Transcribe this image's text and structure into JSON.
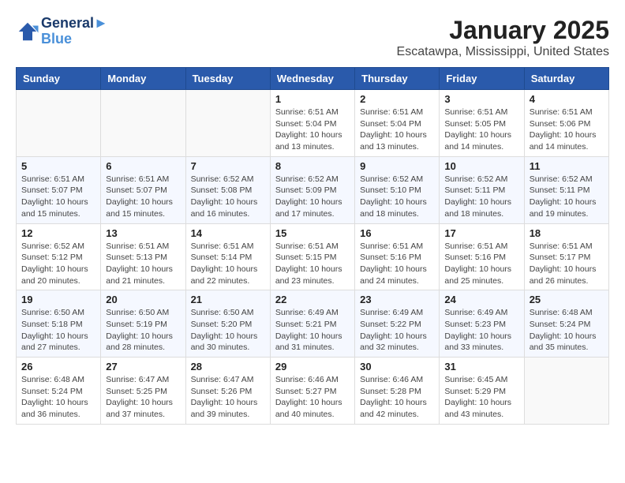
{
  "logo": {
    "line1": "General",
    "line2": "Blue"
  },
  "title": "January 2025",
  "subtitle": "Escatawpa, Mississippi, United States",
  "days_of_week": [
    "Sunday",
    "Monday",
    "Tuesday",
    "Wednesday",
    "Thursday",
    "Friday",
    "Saturday"
  ],
  "weeks": [
    [
      {
        "day": "",
        "info": ""
      },
      {
        "day": "",
        "info": ""
      },
      {
        "day": "",
        "info": ""
      },
      {
        "day": "1",
        "info": "Sunrise: 6:51 AM\nSunset: 5:04 PM\nDaylight: 10 hours\nand 13 minutes."
      },
      {
        "day": "2",
        "info": "Sunrise: 6:51 AM\nSunset: 5:04 PM\nDaylight: 10 hours\nand 13 minutes."
      },
      {
        "day": "3",
        "info": "Sunrise: 6:51 AM\nSunset: 5:05 PM\nDaylight: 10 hours\nand 14 minutes."
      },
      {
        "day": "4",
        "info": "Sunrise: 6:51 AM\nSunset: 5:06 PM\nDaylight: 10 hours\nand 14 minutes."
      }
    ],
    [
      {
        "day": "5",
        "info": "Sunrise: 6:51 AM\nSunset: 5:07 PM\nDaylight: 10 hours\nand 15 minutes."
      },
      {
        "day": "6",
        "info": "Sunrise: 6:51 AM\nSunset: 5:07 PM\nDaylight: 10 hours\nand 15 minutes."
      },
      {
        "day": "7",
        "info": "Sunrise: 6:52 AM\nSunset: 5:08 PM\nDaylight: 10 hours\nand 16 minutes."
      },
      {
        "day": "8",
        "info": "Sunrise: 6:52 AM\nSunset: 5:09 PM\nDaylight: 10 hours\nand 17 minutes."
      },
      {
        "day": "9",
        "info": "Sunrise: 6:52 AM\nSunset: 5:10 PM\nDaylight: 10 hours\nand 18 minutes."
      },
      {
        "day": "10",
        "info": "Sunrise: 6:52 AM\nSunset: 5:11 PM\nDaylight: 10 hours\nand 18 minutes."
      },
      {
        "day": "11",
        "info": "Sunrise: 6:52 AM\nSunset: 5:11 PM\nDaylight: 10 hours\nand 19 minutes."
      }
    ],
    [
      {
        "day": "12",
        "info": "Sunrise: 6:52 AM\nSunset: 5:12 PM\nDaylight: 10 hours\nand 20 minutes."
      },
      {
        "day": "13",
        "info": "Sunrise: 6:51 AM\nSunset: 5:13 PM\nDaylight: 10 hours\nand 21 minutes."
      },
      {
        "day": "14",
        "info": "Sunrise: 6:51 AM\nSunset: 5:14 PM\nDaylight: 10 hours\nand 22 minutes."
      },
      {
        "day": "15",
        "info": "Sunrise: 6:51 AM\nSunset: 5:15 PM\nDaylight: 10 hours\nand 23 minutes."
      },
      {
        "day": "16",
        "info": "Sunrise: 6:51 AM\nSunset: 5:16 PM\nDaylight: 10 hours\nand 24 minutes."
      },
      {
        "day": "17",
        "info": "Sunrise: 6:51 AM\nSunset: 5:16 PM\nDaylight: 10 hours\nand 25 minutes."
      },
      {
        "day": "18",
        "info": "Sunrise: 6:51 AM\nSunset: 5:17 PM\nDaylight: 10 hours\nand 26 minutes."
      }
    ],
    [
      {
        "day": "19",
        "info": "Sunrise: 6:50 AM\nSunset: 5:18 PM\nDaylight: 10 hours\nand 27 minutes."
      },
      {
        "day": "20",
        "info": "Sunrise: 6:50 AM\nSunset: 5:19 PM\nDaylight: 10 hours\nand 28 minutes."
      },
      {
        "day": "21",
        "info": "Sunrise: 6:50 AM\nSunset: 5:20 PM\nDaylight: 10 hours\nand 30 minutes."
      },
      {
        "day": "22",
        "info": "Sunrise: 6:49 AM\nSunset: 5:21 PM\nDaylight: 10 hours\nand 31 minutes."
      },
      {
        "day": "23",
        "info": "Sunrise: 6:49 AM\nSunset: 5:22 PM\nDaylight: 10 hours\nand 32 minutes."
      },
      {
        "day": "24",
        "info": "Sunrise: 6:49 AM\nSunset: 5:23 PM\nDaylight: 10 hours\nand 33 minutes."
      },
      {
        "day": "25",
        "info": "Sunrise: 6:48 AM\nSunset: 5:24 PM\nDaylight: 10 hours\nand 35 minutes."
      }
    ],
    [
      {
        "day": "26",
        "info": "Sunrise: 6:48 AM\nSunset: 5:24 PM\nDaylight: 10 hours\nand 36 minutes."
      },
      {
        "day": "27",
        "info": "Sunrise: 6:47 AM\nSunset: 5:25 PM\nDaylight: 10 hours\nand 37 minutes."
      },
      {
        "day": "28",
        "info": "Sunrise: 6:47 AM\nSunset: 5:26 PM\nDaylight: 10 hours\nand 39 minutes."
      },
      {
        "day": "29",
        "info": "Sunrise: 6:46 AM\nSunset: 5:27 PM\nDaylight: 10 hours\nand 40 minutes."
      },
      {
        "day": "30",
        "info": "Sunrise: 6:46 AM\nSunset: 5:28 PM\nDaylight: 10 hours\nand 42 minutes."
      },
      {
        "day": "31",
        "info": "Sunrise: 6:45 AM\nSunset: 5:29 PM\nDaylight: 10 hours\nand 43 minutes."
      },
      {
        "day": "",
        "info": ""
      }
    ]
  ]
}
